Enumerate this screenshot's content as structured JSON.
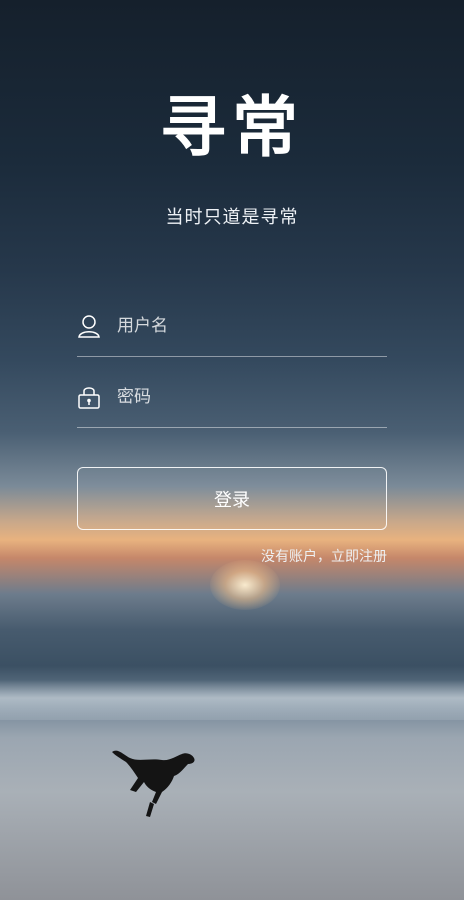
{
  "app": {
    "logo": "寻常",
    "tagline": "当时只道是寻常"
  },
  "form": {
    "username": {
      "placeholder": "用户名",
      "value": "",
      "icon": "user-icon"
    },
    "password": {
      "placeholder": "密码",
      "value": "",
      "icon": "lock-icon"
    },
    "login_label": "登录",
    "register_label": "没有账户，立即注册"
  },
  "colors": {
    "text": "#ffffff",
    "sky_top": "#15202c",
    "sunset": "#e8b27f"
  }
}
